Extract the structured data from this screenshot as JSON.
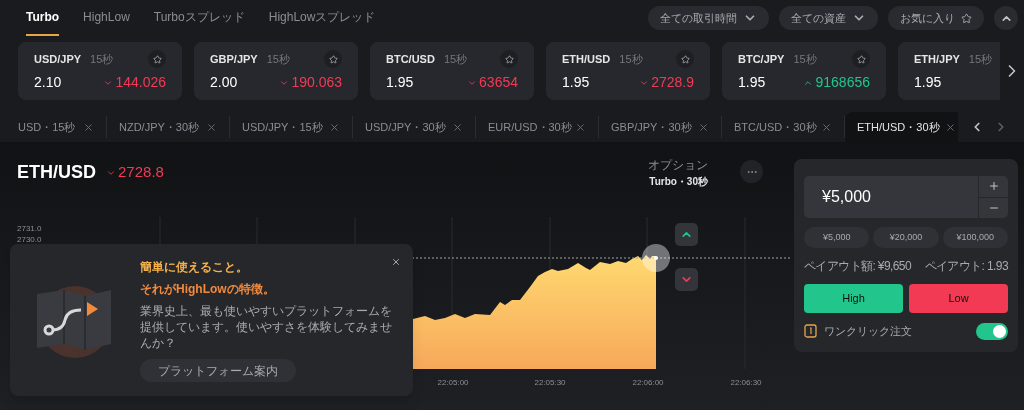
{
  "nav": {
    "tabs": [
      {
        "label": "Turbo",
        "selected": true
      },
      {
        "label": "HighLow",
        "selected": false
      },
      {
        "label": "Turboスプレッド",
        "selected": false
      },
      {
        "label": "HighLowスプレッド",
        "selected": false
      }
    ],
    "filters": [
      {
        "label": "全ての取引時間",
        "kind": "dropdown"
      },
      {
        "label": "全ての資産",
        "kind": "dropdown"
      },
      {
        "label": "お気に入り",
        "kind": "favorite"
      }
    ]
  },
  "assets": [
    {
      "name": "USD/JPY",
      "duration": "15秒",
      "payout": "2.10",
      "price": "144.026",
      "rising": false
    },
    {
      "name": "GBP/JPY",
      "duration": "15秒",
      "payout": "2.00",
      "price": "190.063",
      "rising": false
    },
    {
      "name": "BTC/USD",
      "duration": "15秒",
      "payout": "1.95",
      "price": "63654",
      "rising": false
    },
    {
      "name": "ETH/USD",
      "duration": "15秒",
      "payout": "1.95",
      "price": "2728.9",
      "rising": false
    },
    {
      "name": "BTC/JPY",
      "duration": "15秒",
      "payout": "1.95",
      "price": "9168656",
      "rising": true
    },
    {
      "name": "ETH/JPY",
      "duration": "15秒",
      "payout": "1.95"
    }
  ],
  "open_tabs": [
    {
      "label": "USD・15秒",
      "selected": false
    },
    {
      "label": "NZD/JPY・30秒",
      "selected": false
    },
    {
      "label": "USD/JPY・15秒",
      "selected": false
    },
    {
      "label": "USD/JPY・30秒",
      "selected": false
    },
    {
      "label": "EUR/USD・30秒",
      "selected": false
    },
    {
      "label": "GBP/JPY・30秒",
      "selected": false
    },
    {
      "label": "BTC/USD・30秒",
      "selected": false
    },
    {
      "label": "ETH/USD・30秒",
      "selected": true
    }
  ],
  "chart": {
    "symbol": "ETH/USD",
    "price": "2728.8",
    "rising": false,
    "option_label": "オプション",
    "option_value": "Turbo・30秒",
    "y_labels": [
      "2731.0",
      "2730.0"
    ],
    "x_labels": [
      "22:05:00",
      "22:05:30",
      "22:06:00",
      "22:06:30"
    ]
  },
  "promo": {
    "title_1": "簡単に使えること。",
    "title_2": "それがHighLowの特徴。",
    "body": "業界史上、最も使いやすいプラットフォームを提供しています。使いやすさを体験してみませんか？",
    "button": "プラットフォーム案内"
  },
  "trade": {
    "amount": "¥5,000",
    "presets": [
      "¥5,000",
      "¥20,000",
      "¥100,000"
    ],
    "payout_amount": "ペイアウト額: ¥9,650",
    "payout_rate": "ペイアウト: 1.93",
    "high": "High",
    "low": "Low",
    "one_click": {
      "label": "ワンクリック注文",
      "on": true
    }
  }
}
